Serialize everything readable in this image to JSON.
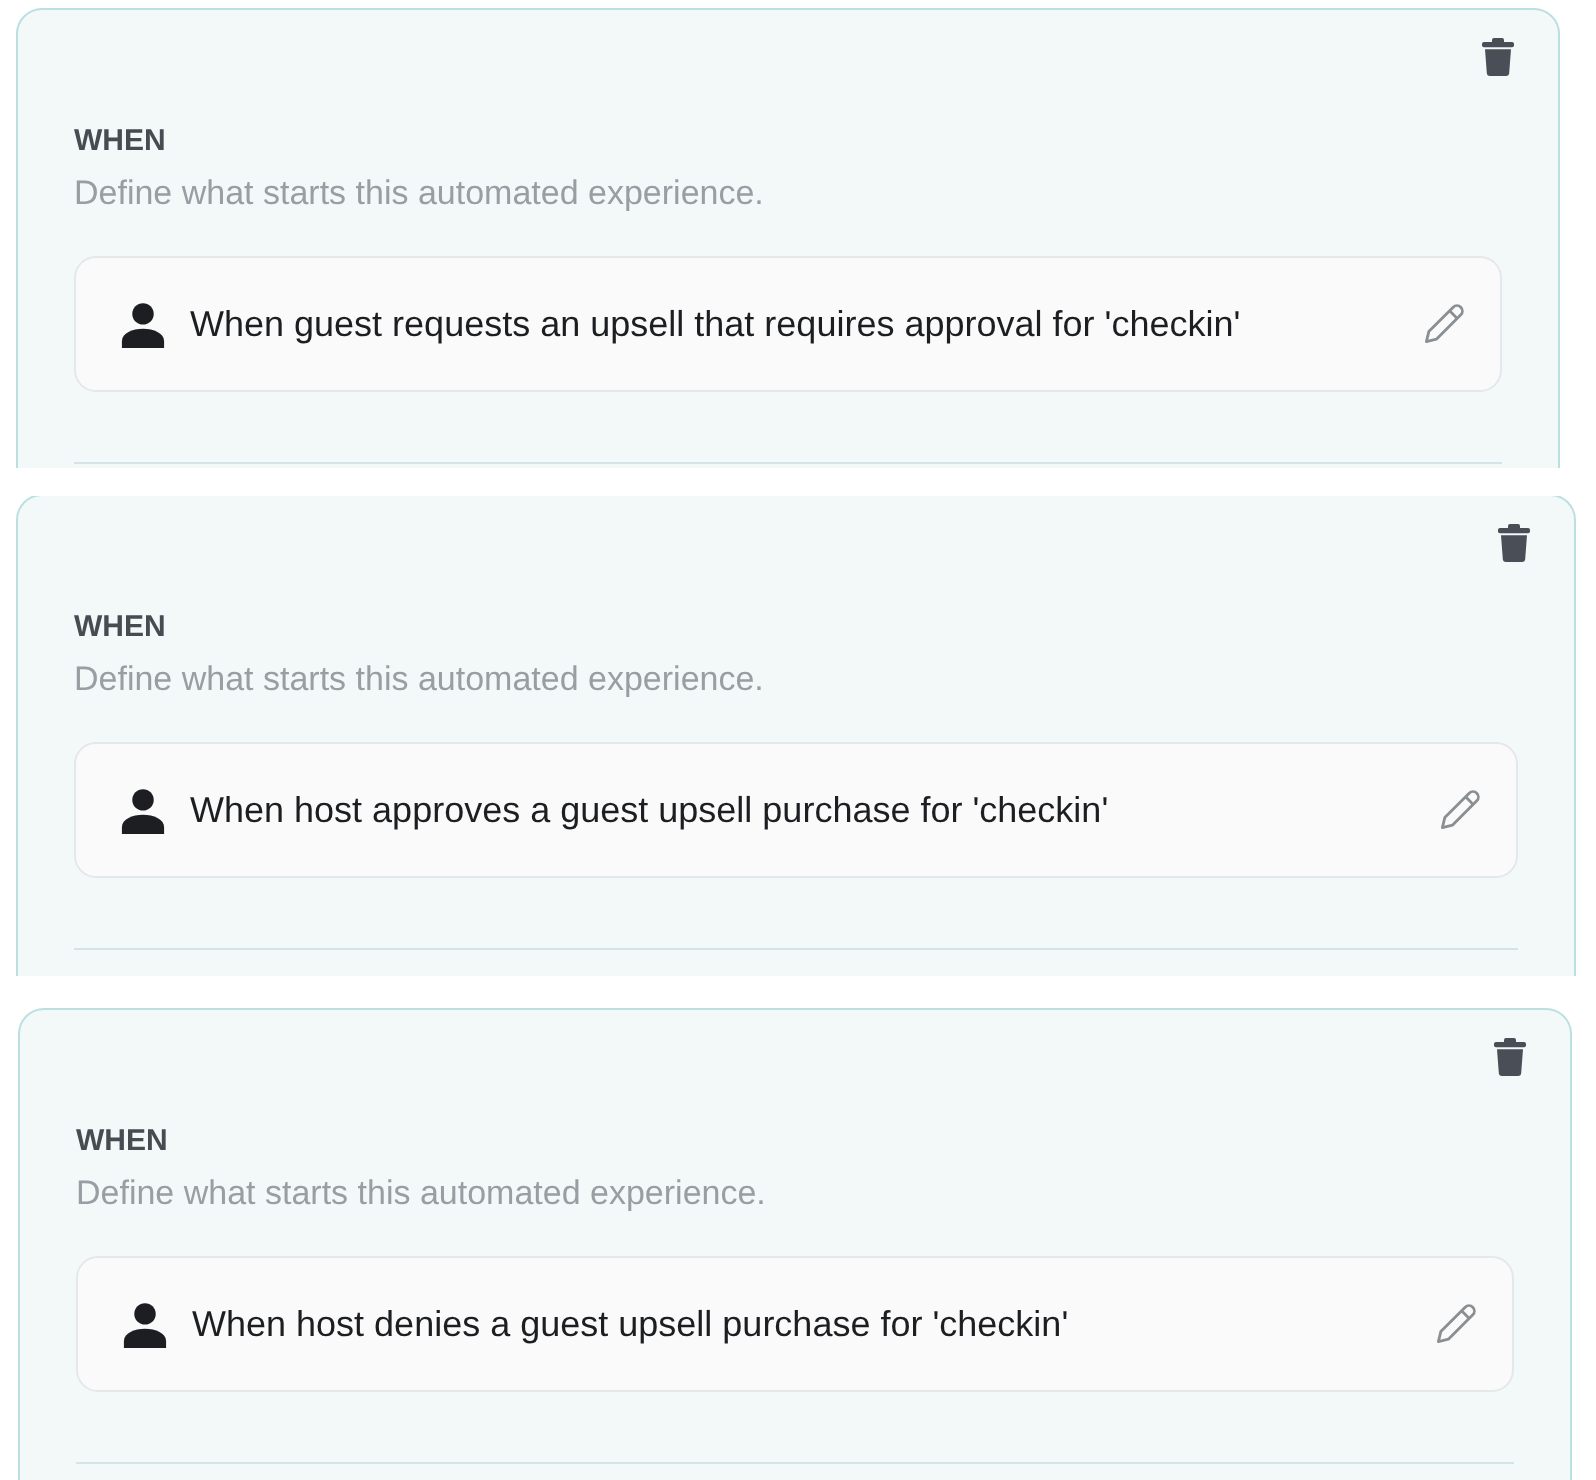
{
  "panels": [
    {
      "heading": "WHEN",
      "description": "Define what starts this automated experience.",
      "trigger": {
        "text": "When guest requests an upsell that requires approval for 'checkin'"
      }
    },
    {
      "heading": "WHEN",
      "description": "Define what starts this automated experience.",
      "trigger": {
        "text": "When host approves a guest upsell purchase for 'checkin'"
      }
    },
    {
      "heading": "WHEN",
      "description": "Define what starts this automated experience.",
      "trigger": {
        "text": "When host denies a guest upsell purchase for 'checkin'"
      }
    }
  ]
}
